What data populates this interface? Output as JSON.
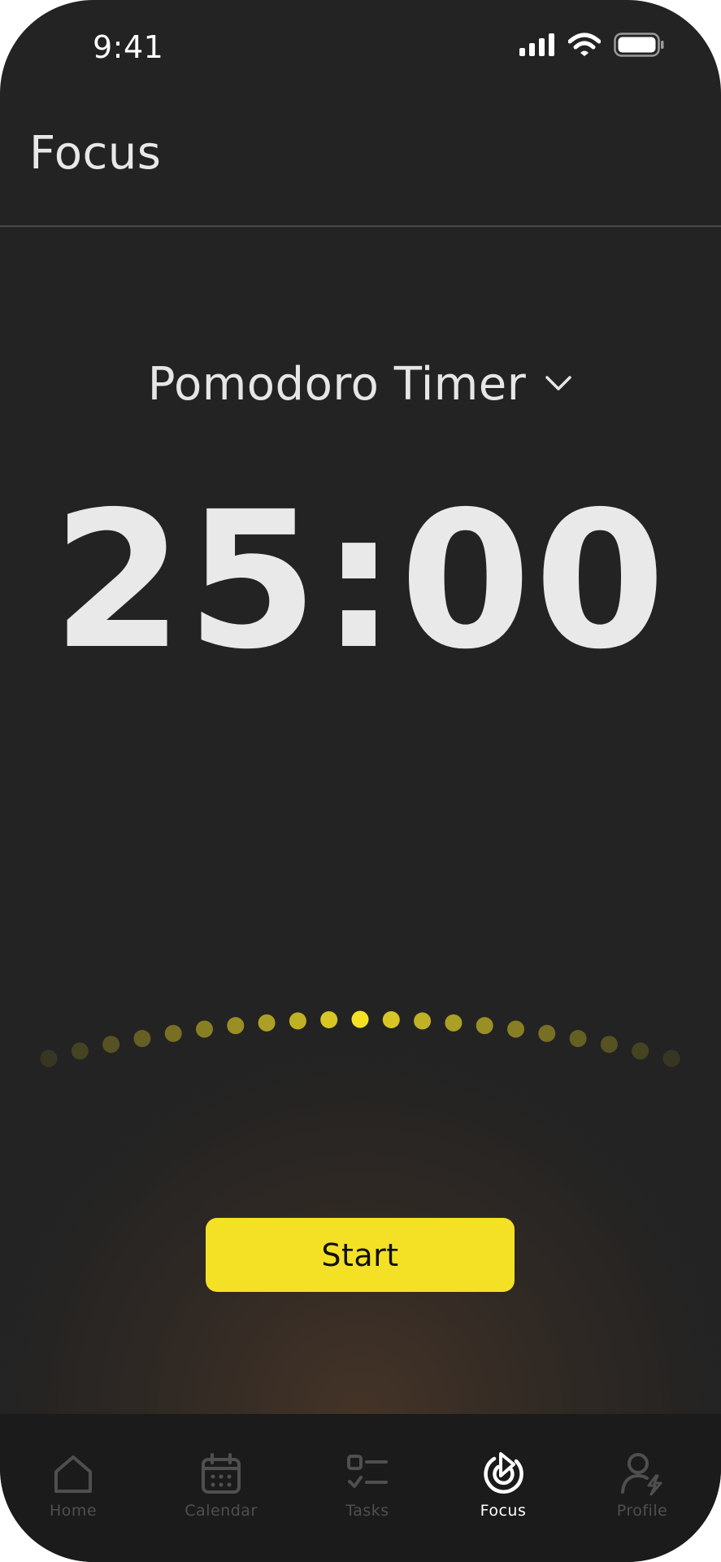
{
  "status_bar": {
    "time": "9:41",
    "icons": [
      "signal-icon",
      "wifi-icon",
      "battery-icon"
    ]
  },
  "header": {
    "title": "Focus"
  },
  "timer": {
    "mode_label": "Pomodoro Timer",
    "display": "25:00"
  },
  "controls": {
    "start_label": "Start"
  },
  "tabs": [
    {
      "label": "Home",
      "icon": "home-icon",
      "active": false
    },
    {
      "label": "Calendar",
      "icon": "calendar-icon",
      "active": false
    },
    {
      "label": "Tasks",
      "icon": "tasks-icon",
      "active": false
    },
    {
      "label": "Focus",
      "icon": "focus-icon",
      "active": true
    },
    {
      "label": "Profile",
      "icon": "profile-icon",
      "active": false
    }
  ],
  "colors": {
    "background": "#232323",
    "accent": "#f4e126",
    "text": "#e8e8e8",
    "tab_inactive": "#4f4f4f",
    "tab_active": "#ffffff",
    "tab_bar": "#1b1b1b"
  }
}
